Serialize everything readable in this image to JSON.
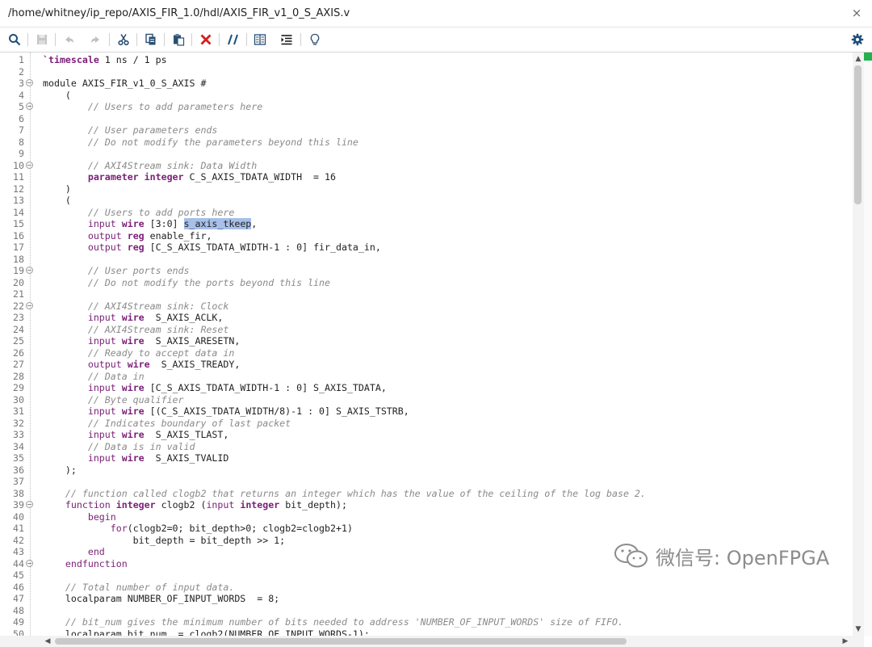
{
  "window": {
    "title": "/home/whitney/ip_repo/AXIS_FIR_1.0/hdl/AXIS_FIR_v1_0_S_AXIS.v",
    "close_glyph": "×"
  },
  "toolbar": {
    "icons": [
      "search-icon",
      "save-icon",
      "undo-icon",
      "redo-icon",
      "cut-icon",
      "copy-icon",
      "paste-icon",
      "delete-icon",
      "comment-toggle-icon",
      "block-select-icon",
      "indent-icon",
      "lightbulb-icon",
      "settings-gear-icon"
    ]
  },
  "editor": {
    "fold_lines": [
      3,
      5,
      10,
      19,
      22,
      39,
      44
    ],
    "highlighted_token": "s_axis_tkeep",
    "colors": {
      "keyword": "#7a1f77",
      "comment": "#8a8a8a",
      "highlight": "#a7c0ea",
      "marker": "#22b14c"
    },
    "lines": [
      {
        "n": "1",
        "tokens": [
          [
            "kw",
            "`timescale"
          ],
          [
            "t",
            " 1 ns / 1 ps"
          ]
        ]
      },
      {
        "n": "2",
        "tokens": []
      },
      {
        "n": "3",
        "tokens": [
          [
            "t",
            "module AXIS_FIR_v1_0_S_AXIS #"
          ]
        ]
      },
      {
        "n": "4",
        "tokens": [
          [
            "t",
            "    ("
          ]
        ]
      },
      {
        "n": "5",
        "tokens": [
          [
            "t",
            "        "
          ],
          [
            "cmt",
            "// Users to add parameters here"
          ]
        ]
      },
      {
        "n": "6",
        "tokens": []
      },
      {
        "n": "7",
        "tokens": [
          [
            "t",
            "        "
          ],
          [
            "cmt",
            "// User parameters ends"
          ]
        ]
      },
      {
        "n": "8",
        "tokens": [
          [
            "t",
            "        "
          ],
          [
            "cmt",
            "// Do not modify the parameters beyond this line"
          ]
        ]
      },
      {
        "n": "9",
        "tokens": []
      },
      {
        "n": "10",
        "tokens": [
          [
            "t",
            "        "
          ],
          [
            "cmt",
            "// AXI4Stream sink: Data Width"
          ]
        ]
      },
      {
        "n": "11",
        "tokens": [
          [
            "t",
            "        "
          ],
          [
            "kw",
            "parameter integer"
          ],
          [
            "t",
            " C_S_AXIS_TDATA_WIDTH  = 16"
          ]
        ]
      },
      {
        "n": "12",
        "tokens": [
          [
            "t",
            "    )"
          ]
        ]
      },
      {
        "n": "13",
        "tokens": [
          [
            "t",
            "    ("
          ]
        ]
      },
      {
        "n": "14",
        "tokens": [
          [
            "t",
            "        "
          ],
          [
            "cmt",
            "// Users to add ports here"
          ]
        ]
      },
      {
        "n": "15",
        "tokens": [
          [
            "t",
            "        "
          ],
          [
            "kwp",
            "input"
          ],
          [
            "t",
            " "
          ],
          [
            "kw",
            "wire"
          ],
          [
            "t",
            " [3:0] "
          ],
          [
            "hl",
            "s_axis_tkeep"
          ],
          [
            "t",
            ","
          ]
        ]
      },
      {
        "n": "16",
        "tokens": [
          [
            "t",
            "        "
          ],
          [
            "kwp",
            "output"
          ],
          [
            "t",
            " "
          ],
          [
            "kw",
            "reg"
          ],
          [
            "t",
            " enable_fir,"
          ]
        ]
      },
      {
        "n": "17",
        "tokens": [
          [
            "t",
            "        "
          ],
          [
            "kwp",
            "output"
          ],
          [
            "t",
            " "
          ],
          [
            "kw",
            "reg"
          ],
          [
            "t",
            " [C_S_AXIS_TDATA_WIDTH-1 : 0] fir_data_in,"
          ]
        ]
      },
      {
        "n": "18",
        "tokens": []
      },
      {
        "n": "19",
        "tokens": [
          [
            "t",
            "        "
          ],
          [
            "cmt",
            "// User ports ends"
          ]
        ]
      },
      {
        "n": "20",
        "tokens": [
          [
            "t",
            "        "
          ],
          [
            "cmt",
            "// Do not modify the ports beyond this line"
          ]
        ]
      },
      {
        "n": "21",
        "tokens": []
      },
      {
        "n": "22",
        "tokens": [
          [
            "t",
            "        "
          ],
          [
            "cmt",
            "// AXI4Stream sink: Clock"
          ]
        ]
      },
      {
        "n": "23",
        "tokens": [
          [
            "t",
            "        "
          ],
          [
            "kwp",
            "input"
          ],
          [
            "t",
            " "
          ],
          [
            "kw",
            "wire"
          ],
          [
            "t",
            "  S_AXIS_ACLK,"
          ]
        ]
      },
      {
        "n": "24",
        "tokens": [
          [
            "t",
            "        "
          ],
          [
            "cmt",
            "// AXI4Stream sink: Reset"
          ]
        ]
      },
      {
        "n": "25",
        "tokens": [
          [
            "t",
            "        "
          ],
          [
            "kwp",
            "input"
          ],
          [
            "t",
            " "
          ],
          [
            "kw",
            "wire"
          ],
          [
            "t",
            "  S_AXIS_ARESETN,"
          ]
        ]
      },
      {
        "n": "26",
        "tokens": [
          [
            "t",
            "        "
          ],
          [
            "cmt",
            "// Ready to accept data in"
          ]
        ]
      },
      {
        "n": "27",
        "tokens": [
          [
            "t",
            "        "
          ],
          [
            "kwp",
            "output"
          ],
          [
            "t",
            " "
          ],
          [
            "kw",
            "wire"
          ],
          [
            "t",
            "  S_AXIS_TREADY,"
          ]
        ]
      },
      {
        "n": "28",
        "tokens": [
          [
            "t",
            "        "
          ],
          [
            "cmt",
            "// Data in"
          ]
        ]
      },
      {
        "n": "29",
        "tokens": [
          [
            "t",
            "        "
          ],
          [
            "kwp",
            "input"
          ],
          [
            "t",
            " "
          ],
          [
            "kw",
            "wire"
          ],
          [
            "t",
            " [C_S_AXIS_TDATA_WIDTH-1 : 0] S_AXIS_TDATA,"
          ]
        ]
      },
      {
        "n": "30",
        "tokens": [
          [
            "t",
            "        "
          ],
          [
            "cmt",
            "// Byte qualifier"
          ]
        ]
      },
      {
        "n": "31",
        "tokens": [
          [
            "t",
            "        "
          ],
          [
            "kwp",
            "input"
          ],
          [
            "t",
            " "
          ],
          [
            "kw",
            "wire"
          ],
          [
            "t",
            " [(C_S_AXIS_TDATA_WIDTH/8)-1 : 0] S_AXIS_TSTRB,"
          ]
        ]
      },
      {
        "n": "32",
        "tokens": [
          [
            "t",
            "        "
          ],
          [
            "cmt",
            "// Indicates boundary of last packet"
          ]
        ]
      },
      {
        "n": "33",
        "tokens": [
          [
            "t",
            "        "
          ],
          [
            "kwp",
            "input"
          ],
          [
            "t",
            " "
          ],
          [
            "kw",
            "wire"
          ],
          [
            "t",
            "  S_AXIS_TLAST,"
          ]
        ]
      },
      {
        "n": "34",
        "tokens": [
          [
            "t",
            "        "
          ],
          [
            "cmt",
            "// Data is in valid"
          ]
        ]
      },
      {
        "n": "35",
        "tokens": [
          [
            "t",
            "        "
          ],
          [
            "kwp",
            "input"
          ],
          [
            "t",
            " "
          ],
          [
            "kw",
            "wire"
          ],
          [
            "t",
            "  S_AXIS_TVALID"
          ]
        ]
      },
      {
        "n": "36",
        "tokens": [
          [
            "t",
            "    );"
          ]
        ]
      },
      {
        "n": "37",
        "tokens": []
      },
      {
        "n": "38",
        "tokens": [
          [
            "t",
            "    "
          ],
          [
            "cmt",
            "// function called clogb2 that returns an integer which has the value of the ceiling of the log base 2."
          ]
        ]
      },
      {
        "n": "39",
        "tokens": [
          [
            "t",
            "    "
          ],
          [
            "kwp",
            "function"
          ],
          [
            "t",
            " "
          ],
          [
            "kw",
            "integer"
          ],
          [
            "t",
            " clogb2 ("
          ],
          [
            "kwp",
            "input"
          ],
          [
            "t",
            " "
          ],
          [
            "kw",
            "integer"
          ],
          [
            "t",
            " bit_depth);"
          ]
        ]
      },
      {
        "n": "40",
        "tokens": [
          [
            "t",
            "        "
          ],
          [
            "kwp",
            "begin"
          ]
        ]
      },
      {
        "n": "41",
        "tokens": [
          [
            "t",
            "            "
          ],
          [
            "kwp",
            "for"
          ],
          [
            "t",
            "(clogb2=0; bit_depth>0; clogb2=clogb2+1)"
          ]
        ]
      },
      {
        "n": "42",
        "tokens": [
          [
            "t",
            "                bit_depth = bit_depth >> 1;"
          ]
        ]
      },
      {
        "n": "43",
        "tokens": [
          [
            "t",
            "        "
          ],
          [
            "kwp",
            "end"
          ]
        ]
      },
      {
        "n": "44",
        "tokens": [
          [
            "t",
            "    "
          ],
          [
            "kwp",
            "endfunction"
          ]
        ]
      },
      {
        "n": "45",
        "tokens": []
      },
      {
        "n": "46",
        "tokens": [
          [
            "t",
            "    "
          ],
          [
            "cmt",
            "// Total number of input data."
          ]
        ]
      },
      {
        "n": "47",
        "tokens": [
          [
            "t",
            "    localparam NUMBER_OF_INPUT_WORDS  = 8;"
          ]
        ]
      },
      {
        "n": "48",
        "tokens": []
      },
      {
        "n": "49",
        "tokens": [
          [
            "t",
            "    "
          ],
          [
            "cmt",
            "// bit_num gives the minimum number of bits needed to address 'NUMBER_OF_INPUT_WORDS' size of FIFO."
          ]
        ]
      },
      {
        "n": "50",
        "tokens": [
          [
            "t",
            "    localparam bit_num  = clogb2(NUMBER_OF_INPUT_WORDS-1);"
          ]
        ]
      }
    ]
  },
  "scrollbars": {
    "vertical_position": 0.0,
    "arrows": {
      "up": "▲",
      "down": "▼",
      "left": "◀",
      "right": "▶"
    }
  },
  "watermark": {
    "text": "微信号: OpenFPGA"
  }
}
